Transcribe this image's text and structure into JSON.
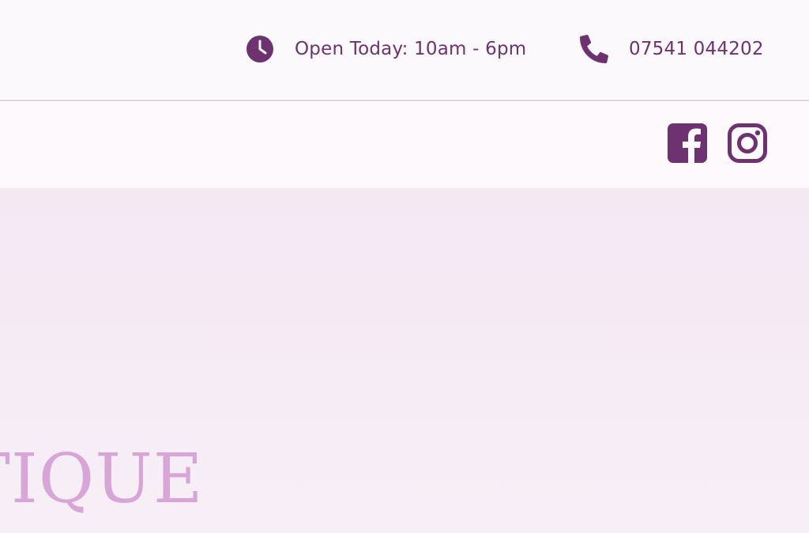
{
  "topbar": {
    "hours_text": "Open Today: 10am - 6pm",
    "phone_text": "07541 044202",
    "hours_icon": "clock-icon",
    "phone_icon": "phone-icon"
  },
  "navbar": {
    "social": [
      {
        "name": "facebook",
        "icon": "facebook-icon"
      },
      {
        "name": "instagram",
        "icon": "instagram-icon"
      }
    ]
  },
  "hero": {
    "title_fragment": "UTIQUE"
  },
  "colors": {
    "brand_purple": "#6e3270",
    "hero_text": "#d8a6d6",
    "hero_bg": "#f5ebf4"
  }
}
